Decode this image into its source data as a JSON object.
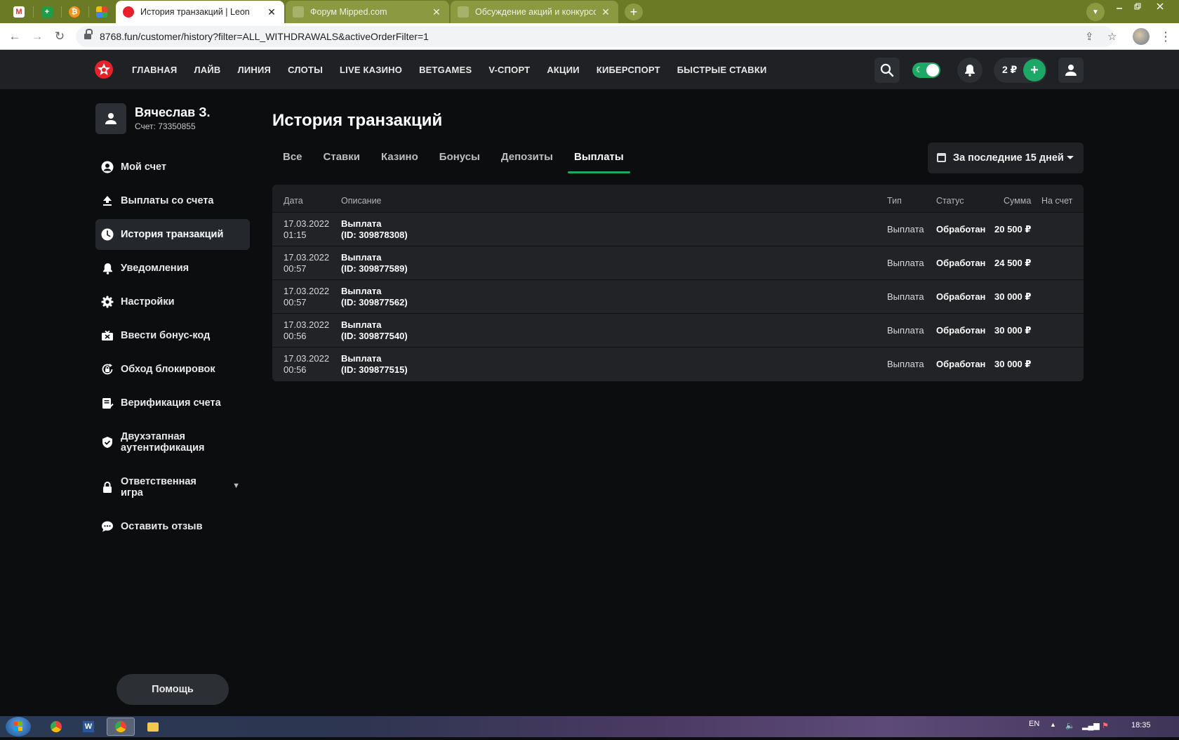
{
  "browser": {
    "tabs": [
      {
        "title": "История транзакций | Leon",
        "close": "✕"
      },
      {
        "title": "Форум Mipped.com",
        "close": "✕"
      },
      {
        "title": "Обсуждение акций и конкурсов",
        "close": "✕"
      }
    ],
    "new_tab": "+",
    "url": "8768.fun/customer/history?filter=ALL_WITHDRAWALS&activeOrderFilter=1"
  },
  "site": {
    "nav": [
      "ГЛАВНАЯ",
      "ЛАЙВ",
      "ЛИНИЯ",
      "СЛОТЫ",
      "LIVE КАЗИНО",
      "BETGAMES",
      "V-СПОРТ",
      "АКЦИИ",
      "КИБЕРСПОРТ",
      "БЫСТРЫЕ СТАВКИ"
    ],
    "balance": "2 ₽",
    "accent_color": "#1ea866",
    "logo_color": "#e8202a"
  },
  "user": {
    "name": "Вячеслав З.",
    "account": "Счет: 73350855"
  },
  "sidebar": {
    "items": [
      {
        "label": "Мой счет",
        "icon": "account-circle-icon"
      },
      {
        "label": "Выплаты со счета",
        "icon": "upload-icon"
      },
      {
        "label": "История транзакций",
        "icon": "clock-icon"
      },
      {
        "label": "Уведомления",
        "icon": "bell-icon"
      },
      {
        "label": "Настройки",
        "icon": "gear-icon"
      },
      {
        "label": "Ввести бонус-код",
        "icon": "gift-icon"
      },
      {
        "label": "Обход блокировок",
        "icon": "lock-refresh-icon"
      },
      {
        "label": "Верификация счета",
        "icon": "verify-document-icon"
      },
      {
        "label": "Двухэтапная аутентификация",
        "icon": "shield-check-icon"
      },
      {
        "label": "Ответственная игра",
        "icon": "lock-icon"
      },
      {
        "label": "Оставить отзыв",
        "icon": "chat-bubble-icon"
      }
    ],
    "help": "Помощь"
  },
  "main": {
    "title": "История транзакций",
    "tabs": [
      "Все",
      "Ставки",
      "Казино",
      "Бонусы",
      "Депозиты",
      "Выплаты"
    ],
    "active_tab": "Выплаты",
    "period": "За последние 15 дней",
    "columns": {
      "date": "Дата",
      "description": "Описание",
      "type": "Тип",
      "status": "Статус",
      "amount": "Сумма",
      "to_account": "На счет"
    },
    "rows": [
      {
        "date": "17.03.2022",
        "time": "01:15",
        "title": "Выплата",
        "id": "(ID: 309878308)",
        "type": "Выплата",
        "status": "Обработан",
        "amount": "20 500 ₽"
      },
      {
        "date": "17.03.2022",
        "time": "00:57",
        "title": "Выплата",
        "id": "(ID: 309877589)",
        "type": "Выплата",
        "status": "Обработан",
        "amount": "24 500 ₽"
      },
      {
        "date": "17.03.2022",
        "time": "00:57",
        "title": "Выплата",
        "id": "(ID: 309877562)",
        "type": "Выплата",
        "status": "Обработан",
        "amount": "30 000 ₽"
      },
      {
        "date": "17.03.2022",
        "time": "00:56",
        "title": "Выплата",
        "id": "(ID: 309877540)",
        "type": "Выплата",
        "status": "Обработан",
        "amount": "30 000 ₽"
      },
      {
        "date": "17.03.2022",
        "time": "00:56",
        "title": "Выплата",
        "id": "(ID: 309877515)",
        "type": "Выплата",
        "status": "Обработан",
        "amount": "30 000 ₽"
      }
    ]
  },
  "taskbar": {
    "lang": "EN",
    "clock": "18:35"
  }
}
